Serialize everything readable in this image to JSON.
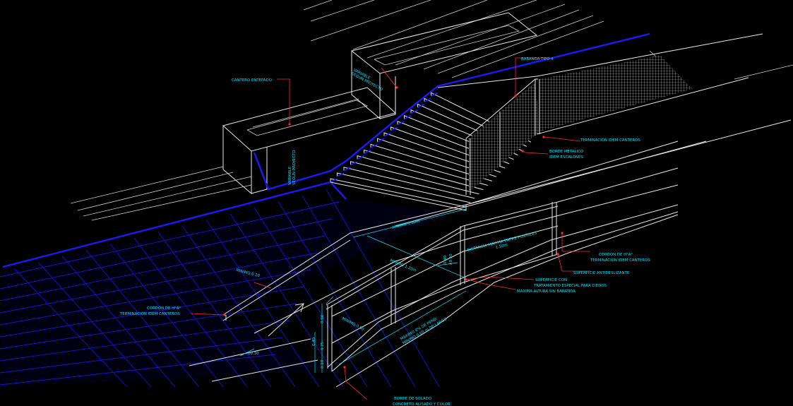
{
  "labels": {
    "cantero_entepado": "CANTERO ENTEPADO",
    "variable_segun_proyecto_top": "VARIABLE\nSEGUN PROYECTO",
    "variable_segun_proyecto_side": "VARIABLE\nSEGUN PROYECTO",
    "baranda_tipo": "BARANDA TIPO 4",
    "terminacion_canteros": "TERMINACION IDEM CANTEROS",
    "borde_metalico": "BORDE METALICO\nIDEM ESCALONES",
    "minimo_top": "MINIMO 1.20m",
    "minimo_mid": "MINIMO 1.20m",
    "distancia_maxima": "DISTANCIA MAXIMA ENTRE PUNTALES\n1.50m",
    "cordon_right": "CORDON DE H°A°\nTERMINACION IDEM CANTEROS",
    "superficie_antideslizante": "SUPERFICIE ANTIDESLIZANTE",
    "superficie_con": "SUPERFICIE CON\nTRATAMIENTO ESPECIAL PARA CIEGOS",
    "maxima_altura": "MAXIMA ALTURA SIN BARANDA",
    "minimo_010": "MINIMO 0.10",
    "cordon_left": "CORDON DE H°A°\nTERMINACION IDEM CANTEROS",
    "minimo_050": "MINIMO 0.50",
    "maximo_pend": "MAXIMO 8% DE PEND.\nMINIMO 0.60 m DE LARGO",
    "borde_solado": "BORDE DE SOLADO\nCONCRETO ALISADO Y COLOR",
    "dim_090": "0.90",
    "dim_075": "0.75",
    "dim_040": "0.40",
    "dim_010": "0.10",
    "dim_030": "±0.30",
    "dim_030b": "±0.30"
  }
}
